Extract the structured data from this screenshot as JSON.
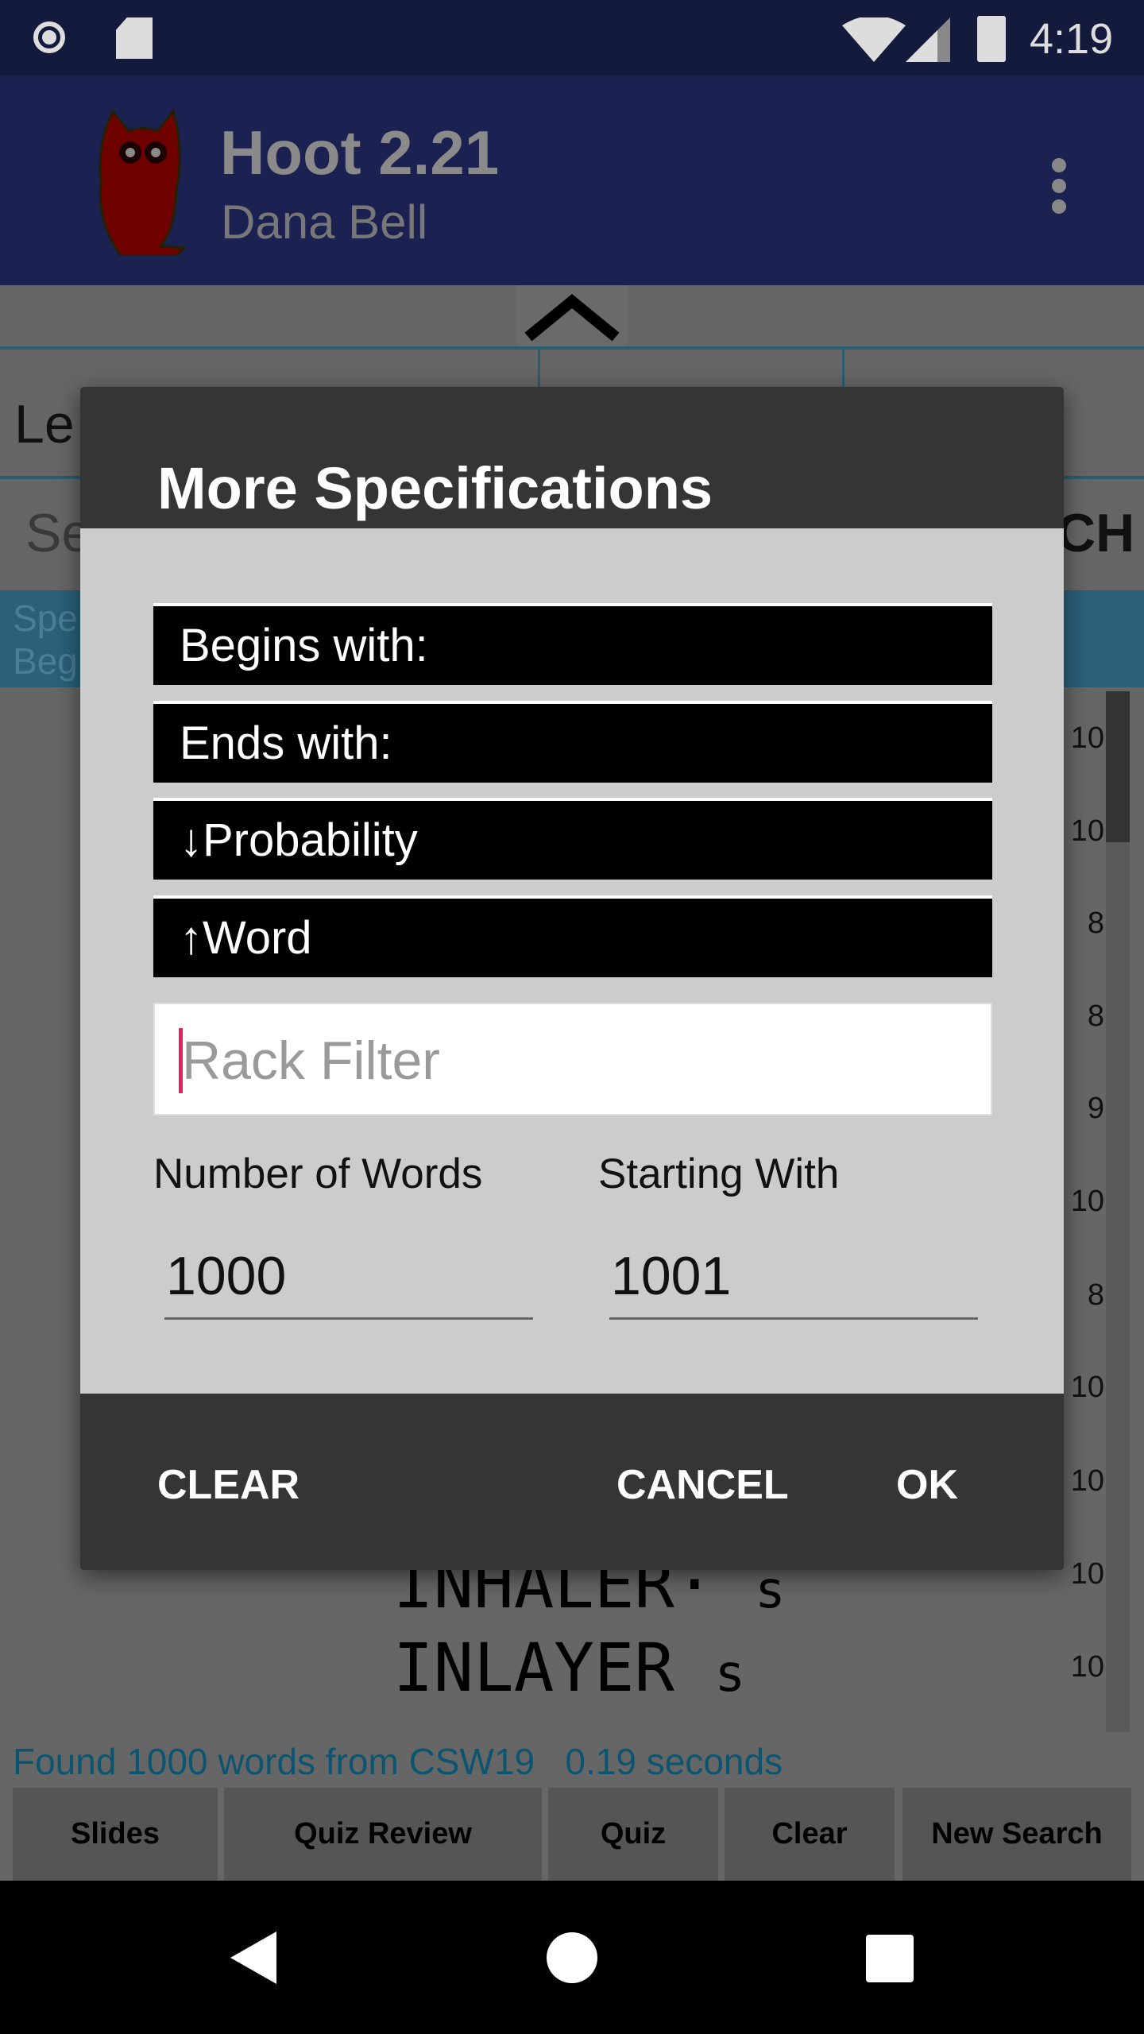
{
  "status_bar": {
    "time": "4:19"
  },
  "app_bar": {
    "title": "Hoot 2.21",
    "subtitle": "Dana Bell"
  },
  "background": {
    "field_label_partial": "Le",
    "search_partial_left": "Se",
    "search_partial_right": "CH",
    "spec_line1_partial": "Spe",
    "spec_line2_partial": "Beg",
    "row_numbers": [
      "10",
      "10",
      "8",
      "8",
      "9",
      "10",
      "8",
      "10",
      "10",
      "10",
      "10"
    ],
    "words": [
      {
        "word": "INHALER·",
        "hook": "s"
      },
      {
        "word": "INLAYER",
        "hook": "s"
      }
    ],
    "found_text": "Found 1000 words from CSW19",
    "time_text": "0.19 seconds",
    "buttons": [
      "Slides",
      "Quiz Review",
      "Quiz",
      "Clear",
      "New Search"
    ]
  },
  "dialog": {
    "title": "More Specifications",
    "rows": [
      "Begins with:",
      "Ends with:",
      "↓Probability",
      "↑Word"
    ],
    "rack_filter_placeholder": "Rack Filter",
    "number_of_words_label": "Number of Words",
    "number_of_words_value": "1000",
    "starting_with_label": "Starting With",
    "starting_with_value": "1001",
    "clear_label": "CLEAR",
    "cancel_label": "CANCEL",
    "ok_label": "OK"
  },
  "colors": {
    "app_bar": "#1b2150",
    "dialog_header": "#353535",
    "dialog_body": "#cccccc",
    "accent_cursor": "#e91e63",
    "found_text": "#0b5570"
  }
}
